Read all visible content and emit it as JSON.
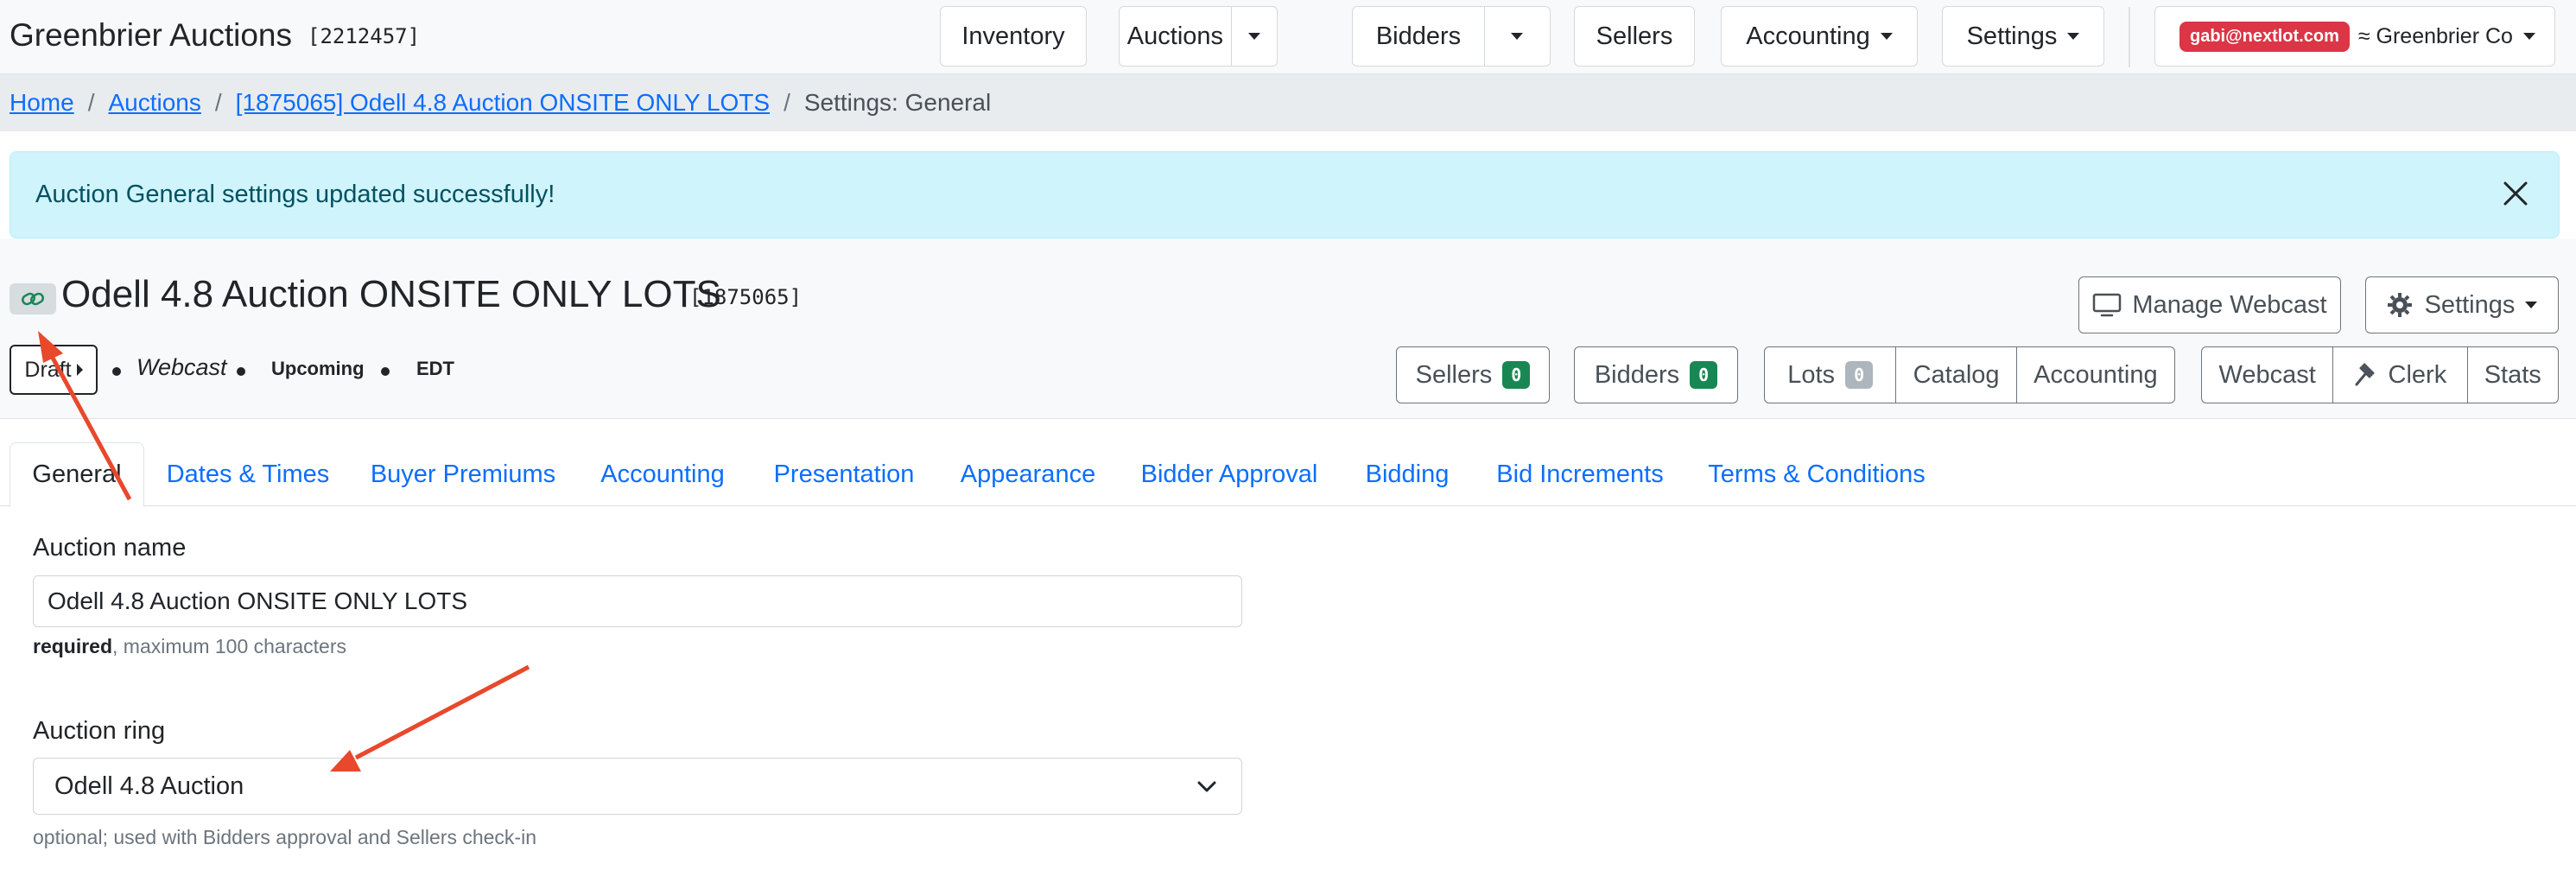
{
  "header": {
    "brand": "Greenbrier Auctions",
    "brand_id": "[2212457]",
    "nav": {
      "inventory": "Inventory",
      "auctions": "Auctions",
      "bidders": "Bidders",
      "sellers": "Sellers",
      "accounting": "Accounting",
      "settings": "Settings"
    },
    "user_email": "gabi@nextlot.com",
    "company": "≈ Greenbrier Co"
  },
  "breadcrumb": {
    "home": "Home",
    "auctions": "Auctions",
    "auction": "[1875065] Odell 4.8 Auction ONSITE ONLY LOTS",
    "current": "Settings: General",
    "sep": "/"
  },
  "alert": {
    "message": "Auction General settings updated successfully!"
  },
  "auction": {
    "title": "Odell 4.8 Auction ONSITE ONLY LOTS",
    "id": "[1875065]",
    "status": "Draft",
    "type": "Webcast",
    "state": "Upcoming",
    "timezone": "EDT"
  },
  "actions": {
    "manage_webcast": "Manage Webcast",
    "settings": "Settings",
    "sellers": "Sellers",
    "sellers_count": "0",
    "bidders": "Bidders",
    "bidders_count": "0",
    "lots": "Lots",
    "lots_count": "0",
    "catalog": "Catalog",
    "accounting": "Accounting",
    "webcast": "Webcast",
    "clerk": "Clerk",
    "stats": "Stats"
  },
  "tabs": [
    {
      "label": "General",
      "active": true
    },
    {
      "label": "Dates & Times"
    },
    {
      "label": "Buyer Premiums"
    },
    {
      "label": "Accounting"
    },
    {
      "label": "Presentation"
    },
    {
      "label": "Appearance"
    },
    {
      "label": "Bidder Approval"
    },
    {
      "label": "Bidding"
    },
    {
      "label": "Bid Increments"
    },
    {
      "label": "Terms & Conditions"
    }
  ],
  "form": {
    "auction_name": {
      "label": "Auction name",
      "value": "Odell 4.8 Auction ONSITE ONLY LOTS",
      "help_strong": "required",
      "help_rest": ", maximum 100 characters"
    },
    "auction_ring": {
      "label": "Auction ring",
      "value": "Odell 4.8 Auction",
      "help": "optional; used with Bidders approval and Sellers check-in"
    }
  },
  "colors": {
    "link": "#0d6efd",
    "alert_bg": "#cff4fc",
    "alert_text": "#055160",
    "badge_red": "#dc3545",
    "count_green": "#198754",
    "count_gray": "#adb5bd",
    "annotation": "#e8482c"
  },
  "icons": {
    "alert_close": "close-icon",
    "link_chip": "link-icon",
    "manage_webcast": "monitor-icon",
    "settings": "gear-icon",
    "clerk": "gavel-icon",
    "select": "chevron-down-icon"
  }
}
